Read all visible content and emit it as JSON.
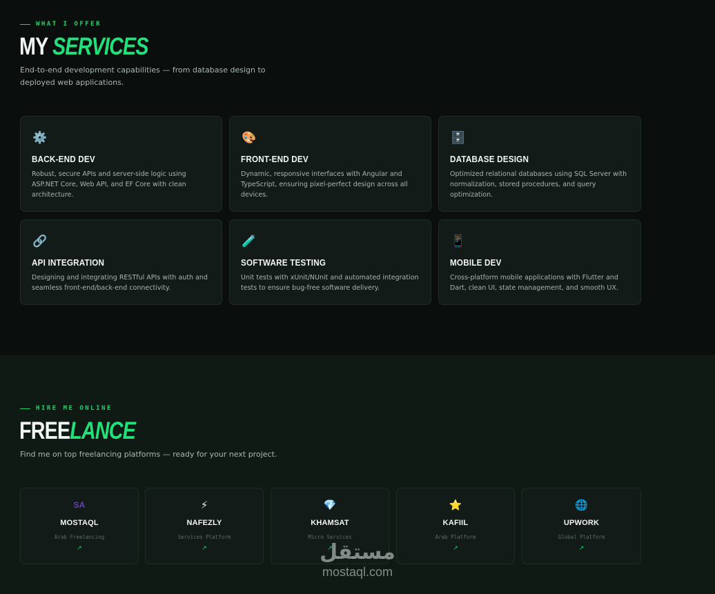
{
  "services": {
    "eyebrow": "WHAT I OFFER",
    "title_white": "MY",
    "title_green": "SERVICES",
    "lead_line1": "End-to-end development capabilities — from database design to",
    "lead_line2": "deployed web applications.",
    "items": [
      {
        "icon": "gear-icon",
        "glyph": "⚙️",
        "title": "BACK-END DEV",
        "desc": "Robust, secure APIs and server-side logic using ASP.NET Core, Web API, and EF Core with clean architecture."
      },
      {
        "icon": "palette-icon",
        "glyph": "🎨",
        "title": "FRONT-END DEV",
        "desc": "Dynamic, responsive interfaces with Angular and TypeScript, ensuring pixel-perfect design across all devices."
      },
      {
        "icon": "database-icon",
        "glyph": "🗄️",
        "title": "DATABASE DESIGN",
        "desc": "Optimized relational databases using SQL Server with normalization, stored procedures, and query optimization."
      },
      {
        "icon": "link-icon",
        "glyph": "🔗",
        "title": "API INTEGRATION",
        "desc": "Designing and integrating RESTful APIs with auth and seamless front-end/back-end connectivity."
      },
      {
        "icon": "test-tube-icon",
        "glyph": "🧪",
        "title": "SOFTWARE TESTING",
        "desc": "Unit tests with xUnit/NUnit and automated integration tests to ensure bug-free software delivery."
      },
      {
        "icon": "mobile-phone-icon",
        "glyph": "📱",
        "title": "MOBILE DEV",
        "desc": "Cross-platform mobile applications with Flutter and Dart, clean UI, state management, and smooth UX."
      }
    ]
  },
  "freelance": {
    "eyebrow": "HIRE ME ONLINE",
    "title_white": "FREE",
    "title_green": "LANCE",
    "lead": "Find me on top freelancing platforms — ready for your next project.",
    "platforms": [
      {
        "icon": "sa-logo-icon",
        "glyph": "SA",
        "name": "MOSTAQL",
        "sub": "Arab Freelancing",
        "arrow": "↗"
      },
      {
        "icon": "lightning-icon",
        "glyph": "⚡",
        "name": "NAFEZLY",
        "sub": "Services Platform",
        "arrow": "↗"
      },
      {
        "icon": "diamond-icon",
        "glyph": "💎",
        "name": "KHAMSAT",
        "sub": "Micro Services",
        "arrow": "↗"
      },
      {
        "icon": "star-icon",
        "glyph": "⭐",
        "name": "KAFIIL",
        "sub": "Arab Platform",
        "arrow": "↗"
      },
      {
        "icon": "globe-icon",
        "glyph": "🌐",
        "name": "UPWORK",
        "sub": "Global Platform",
        "arrow": "↗"
      }
    ]
  },
  "watermark": {
    "arabic": "مستقل",
    "latin": "mostaql.com"
  },
  "colors": {
    "accent": "#22e07a",
    "background_dark": "#0a0f0d",
    "background_freelance": "#0f1a15",
    "card": "#121b17"
  }
}
